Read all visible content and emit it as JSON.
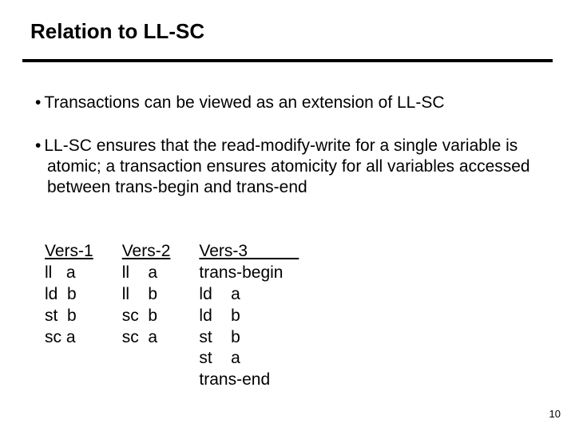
{
  "title": "Relation to LL-SC",
  "bullets": [
    "Transactions can be viewed as an extension of LL-SC",
    "LL-SC ensures that the read-modify-write for a single variable is atomic; a transaction ensures atomicity for all variables accessed between trans-begin and trans-end"
  ],
  "versions": {
    "v1": {
      "head": "Vers-1",
      "rows": [
        "ll   a",
        "ld  b",
        "st  b",
        "sc a"
      ]
    },
    "v2": {
      "head": "Vers-2",
      "rows": [
        "ll    a",
        "ll    b",
        "sc  b",
        "sc  a"
      ]
    },
    "v3": {
      "head": "Vers-3           ",
      "rows": [
        "trans-begin",
        "ld    a",
        "ld    b",
        "st    b",
        "st    a",
        "trans-end"
      ]
    }
  },
  "page_number": "10"
}
